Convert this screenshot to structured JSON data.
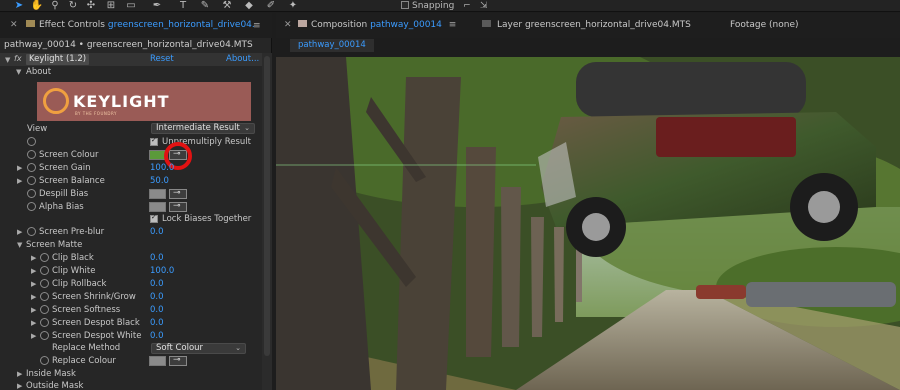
{
  "toolbar": {
    "icons": [
      "selection-tool",
      "hand-tool",
      "zoom-tool",
      "rotate-tool",
      "camera-orbit-tool",
      "pan-behind-tool",
      "rectangle-tool",
      "pen-tool",
      "type-tool",
      "brush-tool",
      "clone-stamp-tool",
      "eraser-tool",
      "roto-brush-tool",
      "puppet-tool"
    ],
    "snapping_label": "Snapping"
  },
  "effect_controls": {
    "tab_title_prefix": "Effect Controls",
    "tab_title_layer": "greenscreen_horizontal_drive04.",
    "layer_path": "pathway_00014 • greenscreen_horizontal_drive04.MTS",
    "effect_name": "Keylight (1.2)",
    "reset_label": "Reset",
    "about_label": "About...",
    "about_group": "About",
    "logo_text": "KEYLIGHT",
    "logo_subtext": "BY THE FOUNDRY",
    "view": {
      "label": "View",
      "value": "Intermediate Result"
    },
    "unpremultiply": {
      "label": "Unpremultiply Result"
    },
    "screen_colour": {
      "label": "Screen Colour",
      "color": "#5b9a3a"
    },
    "screen_gain": {
      "label": "Screen Gain",
      "value": "100.0"
    },
    "screen_balance": {
      "label": "Screen Balance",
      "value": "50.0"
    },
    "despill_bias": {
      "label": "Despill Bias"
    },
    "alpha_bias": {
      "label": "Alpha Bias"
    },
    "lock_biases": {
      "label": "Lock Biases Together"
    },
    "screen_preblur": {
      "label": "Screen Pre-blur",
      "value": "0.0"
    },
    "screen_matte": {
      "label": "Screen Matte"
    },
    "clip_black": {
      "label": "Clip Black",
      "value": "0.0"
    },
    "clip_white": {
      "label": "Clip White",
      "value": "100.0"
    },
    "clip_rollback": {
      "label": "Clip Rollback",
      "value": "0.0"
    },
    "screen_shrink": {
      "label": "Screen Shrink/Grow",
      "value": "0.0"
    },
    "screen_softness": {
      "label": "Screen Softness",
      "value": "0.0"
    },
    "despot_black": {
      "label": "Screen Despot Black",
      "value": "0.0"
    },
    "despot_white": {
      "label": "Screen Despot White",
      "value": "0.0"
    },
    "replace_method": {
      "label": "Replace Method",
      "value": "Soft Colour"
    },
    "replace_colour": {
      "label": "Replace Colour"
    },
    "inside_mask": {
      "label": "Inside Mask"
    },
    "outside_mask": {
      "label": "Outside Mask"
    }
  },
  "composition": {
    "tab_prefix": "Composition",
    "tab_name": "pathway_00014",
    "subtab": "pathway_00014",
    "layer_tab": "Layer greenscreen_horizontal_drive04.MTS",
    "footage_tab": "Footage (none)"
  }
}
